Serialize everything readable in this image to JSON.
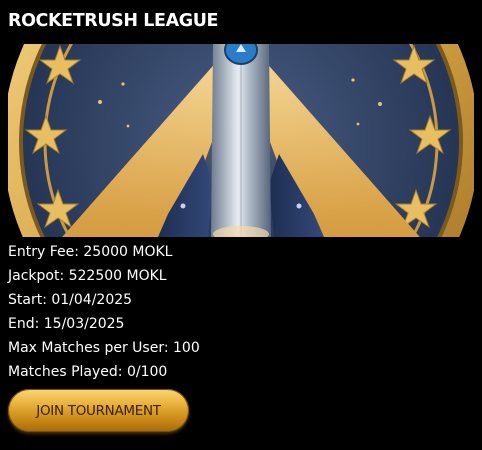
{
  "title": "ROCKETRUSH LEAGUE",
  "banner": {
    "icon": "rocket-emblem-image"
  },
  "info": {
    "entry_fee": "Entry Fee: 25000 MOKL",
    "jackpot": "Jackpot: 522500 MOKL",
    "start": "Start: 01/04/2025",
    "end": "End: 15/03/2025",
    "max_matches": "Max Matches per User: 100",
    "matches_played": "Matches Played: 0/100"
  },
  "join_button": {
    "label": "JOIN TOURNAMENT"
  },
  "colors": {
    "background": "#000000",
    "gold": "#e2b044",
    "navy": "#2c3f63"
  }
}
